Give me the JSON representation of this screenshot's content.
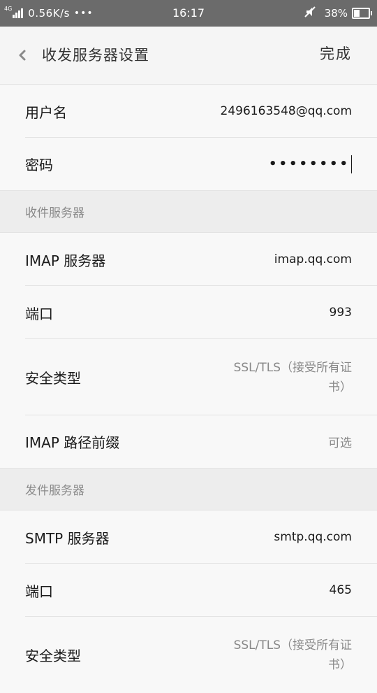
{
  "status_bar": {
    "network_type": "4G",
    "speed": "0.56K/s",
    "dots": "•••",
    "time": "16:17",
    "battery_percent": "38%",
    "battery_level": 0.38,
    "icons": [
      "signal-icon",
      "mute-icon",
      "battery-icon"
    ]
  },
  "header": {
    "title": "收发服务器设置",
    "done_label": "完成",
    "back_icon": "chevron-left-icon"
  },
  "account": {
    "username_label": "用户名",
    "username_value": "2496163548@qq.com",
    "password_label": "密码",
    "password_value": "••••••••"
  },
  "incoming": {
    "section_title": "收件服务器",
    "server_label": "IMAP 服务器",
    "server_value": "imap.qq.com",
    "port_label": "端口",
    "port_value": "993",
    "security_label": "安全类型",
    "security_value": "SSL/TLS（接受所有证书）",
    "path_prefix_label": "IMAP 路径前缀",
    "path_prefix_placeholder": "可选"
  },
  "outgoing": {
    "section_title": "发件服务器",
    "server_label": "SMTP 服务器",
    "server_value": "smtp.qq.com",
    "port_label": "端口",
    "port_value": "465",
    "security_label": "安全类型",
    "security_value": "SSL/TLS（接受所有证书）"
  },
  "colors": {
    "status_bar_bg": "#6b6b6b",
    "page_bg": "#f5f5f5",
    "section_bg": "#ededed",
    "muted_text": "#888888"
  }
}
